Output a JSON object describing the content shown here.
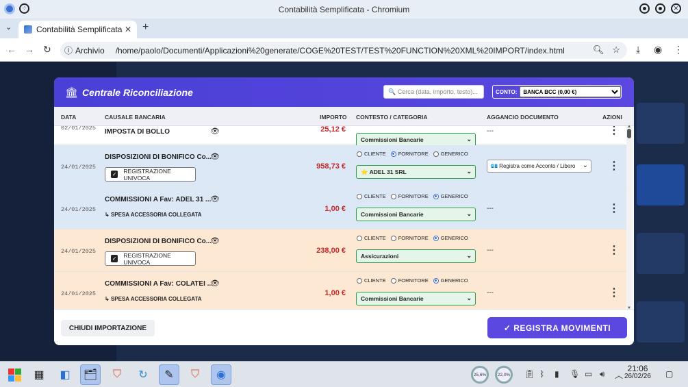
{
  "window": {
    "title": "Contabilità Semplificata - Chromium"
  },
  "tab": {
    "title": "Contabilità Semplificata"
  },
  "address": {
    "chip": "Archivio",
    "url": "/home/paolo/Documenti/Applicazioni%20generate/COGE%20TEST/TEST%20FUNCTION%20XML%20IMPORT/index.html"
  },
  "modal": {
    "title": "Centrale Riconciliazione",
    "search_placeholder": "🔍 Cerca (data, importo, testo)...",
    "conto_label": "CONTO:",
    "conto_value": "BANCA BCC (0,00 €)",
    "headers": {
      "data": "DATA",
      "causale": "CAUSALE BANCARIA",
      "importo": "IMPORTO",
      "contesto": "CONTESTO / CATEGORIA",
      "aggancio": "AGGANCIO DOCUMENTO",
      "azioni": "AZIONI"
    },
    "radio_labels": {
      "cliente": "CLIENTE",
      "fornitore": "FORNITORE",
      "generico": "GENERICO"
    },
    "rows": [
      {
        "date": "02/01/2025",
        "causale": "IMPOSTA DI BOLLO",
        "amount": "25,12 €",
        "category": "Commissioni Bancarie",
        "aggancio": "---",
        "selected": "generico",
        "bg": "#ffffff",
        "sub": "",
        "sub_type": ""
      },
      {
        "date": "24/01/2025",
        "causale": "DISPOSIZIONI DI BONIFICO Co...",
        "amount": "958,73 €",
        "category": "⭐ ADEL 31 SRL",
        "aggancio": "💶 Registra come Acconto / Libero",
        "selected": "fornitore",
        "bg": "#dde8f7",
        "sub": "REGISTRAZIONE UNIVOCA",
        "sub_type": "checkbox"
      },
      {
        "date": "24/01/2025",
        "causale": "COMMISSIONI A Fav: ADEL 31 ...",
        "amount": "1,00 €",
        "category": "Commissioni Bancarie",
        "aggancio": "---",
        "selected": "generico",
        "bg": "#dde8f7",
        "sub": "SPESA ACCESSORIA COLLEGATA",
        "sub_type": "link"
      },
      {
        "date": "24/01/2025",
        "causale": "DISPOSIZIONI DI BONIFICO Co...",
        "amount": "238,00 €",
        "category": "Assicurazioni",
        "aggancio": "---",
        "selected": "generico",
        "bg": "#fde8d4",
        "sub": "REGISTRAZIONE UNIVOCA",
        "sub_type": "checkbox"
      },
      {
        "date": "24/01/2025",
        "causale": "COMMISSIONI A Fav: COLATEI ...",
        "amount": "1,00 €",
        "category": "Commissioni Bancarie",
        "aggancio": "---",
        "selected": "generico",
        "bg": "#fde8d4",
        "sub": "SPESA ACCESSORIA COLLEGATA",
        "sub_type": "link"
      }
    ],
    "close_label": "CHIUDI IMPORTAZIONE",
    "save_label": "✓ REGISTRA MOVIMENTI"
  },
  "taskbar": {
    "cpu": "25,6%",
    "mem": "22,0%",
    "time": "21:06",
    "date": "26/02/26"
  },
  "colors": {
    "accent": "#5a48e0",
    "amount": "#c62828",
    "category_border": "#2e9e4a"
  }
}
